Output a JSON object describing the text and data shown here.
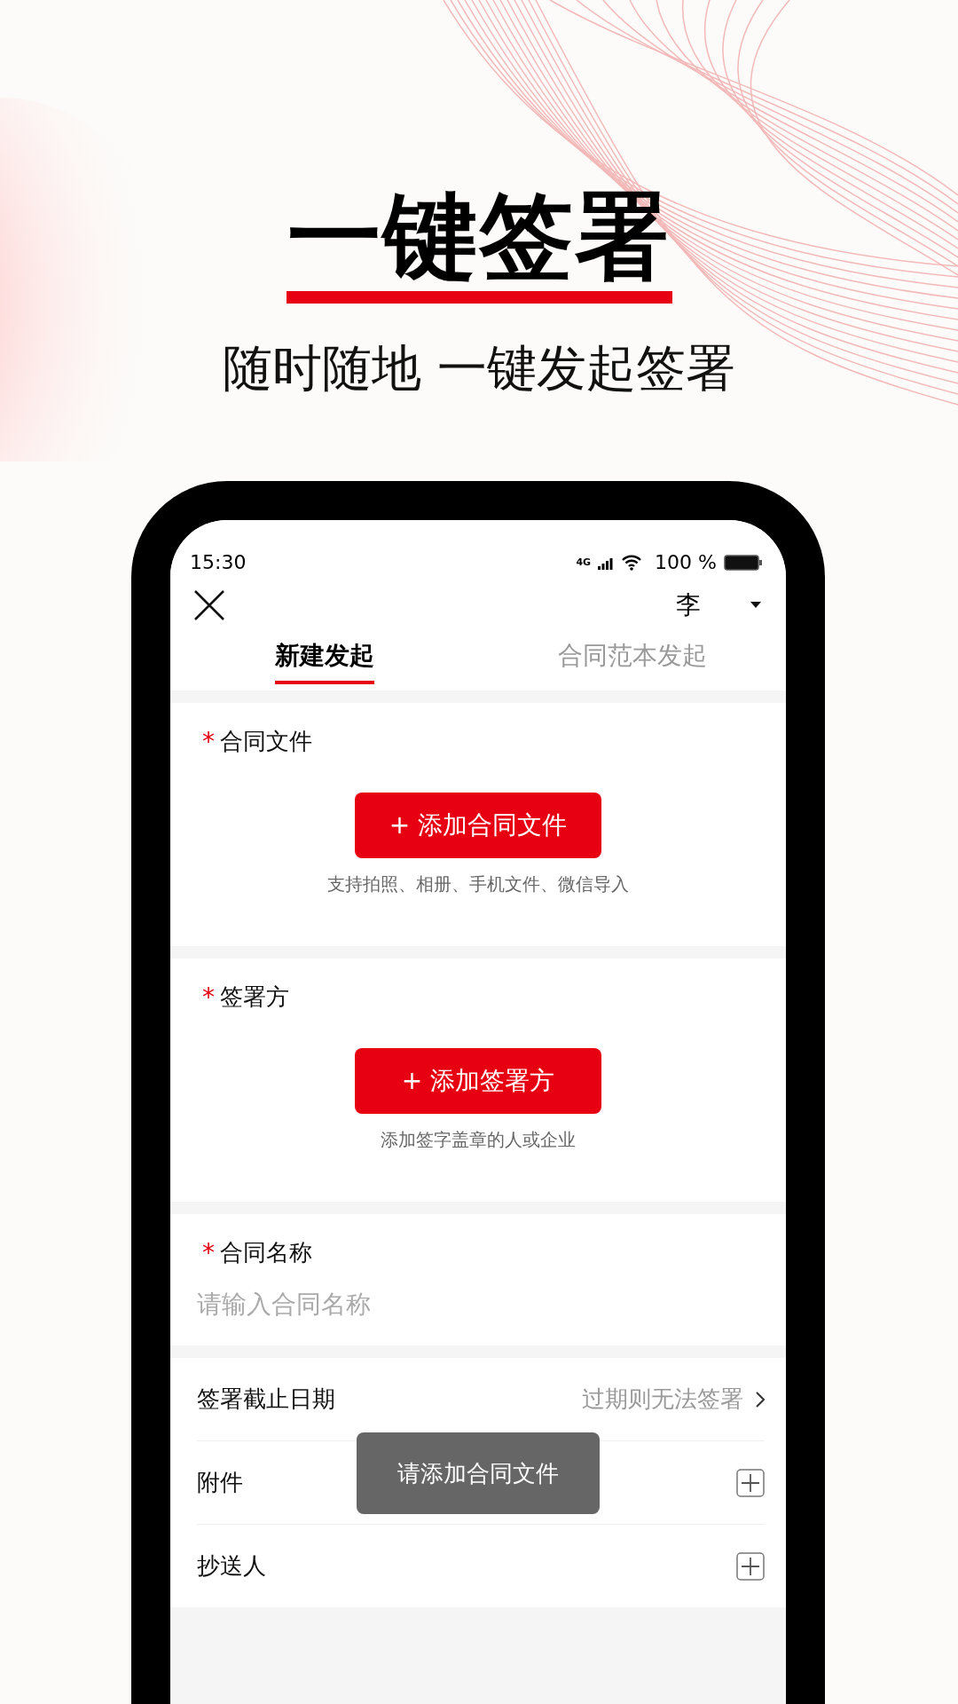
{
  "headline": "一键签署",
  "subtitle": "随时随地 一键发起签署",
  "status_bar": {
    "time": "15:30",
    "network": "4G",
    "battery_text": "100 %"
  },
  "nav": {
    "user": "李"
  },
  "tabs": [
    {
      "label": "新建发起",
      "selected": true
    },
    {
      "label": "合同范本发起",
      "selected": false
    }
  ],
  "sections": [
    {
      "kind": "upload",
      "marker": "*",
      "title": "合同文件",
      "button": "+ 添加合同文件",
      "hint": "支持拍照、相册、手机文件、微信导入"
    },
    {
      "kind": "upload",
      "marker": "*",
      "title": "签署方",
      "button": "+ 添加签署方",
      "hint": "添加签字盖章的人或企业"
    },
    {
      "kind": "input",
      "marker": "*",
      "title": "合同名称",
      "placeholder": "请输入合同名称"
    }
  ],
  "options": [
    {
      "kind": "link",
      "label": "签署截止日期",
      "hint": "过期则无法签署"
    },
    {
      "kind": "add",
      "label": "附件"
    },
    {
      "kind": "add",
      "label": "抄送人"
    }
  ],
  "toast": "请添加合同文件"
}
